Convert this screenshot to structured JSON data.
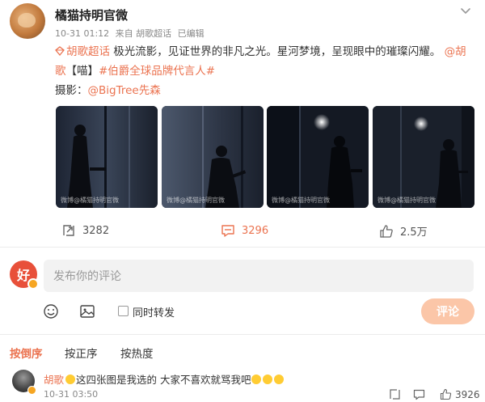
{
  "post": {
    "username": "橘猫持明官微",
    "time": "10-31 01:12",
    "source": "来自 胡歌超话",
    "edited": "已编辑",
    "supertopic": "胡歌超话",
    "text1": "极光流影，见证世界的非凡之光。星河梦境，呈现眼中的璀璨闪耀。",
    "mention1": "@胡",
    "mention1b": "歌",
    "bracket": "【喵】",
    "hashtag": "#伯爵全球品牌代言人#",
    "photo_credit_label": "摄影：",
    "photo_credit": "@BigTree先森",
    "watermark": "微博@橘猫持明官微"
  },
  "actions": {
    "repost_count": "3282",
    "comment_count": "3296",
    "like_count": "2.5万"
  },
  "composer": {
    "avatar_char": "好",
    "placeholder": "发布你的评论",
    "repost_label": "同时转发",
    "submit_label": "评论"
  },
  "sort_tabs": [
    "按倒序",
    "按正序",
    "按热度"
  ],
  "comment": {
    "name": "胡歌",
    "text": "这四张图是我选的 大家不喜欢就骂我吧",
    "time": "10-31 03:50",
    "likes": "3926"
  },
  "colors": {
    "accent": "#eb7350",
    "submit_bg": "#fbc6a8",
    "vip": "#f6a623"
  }
}
